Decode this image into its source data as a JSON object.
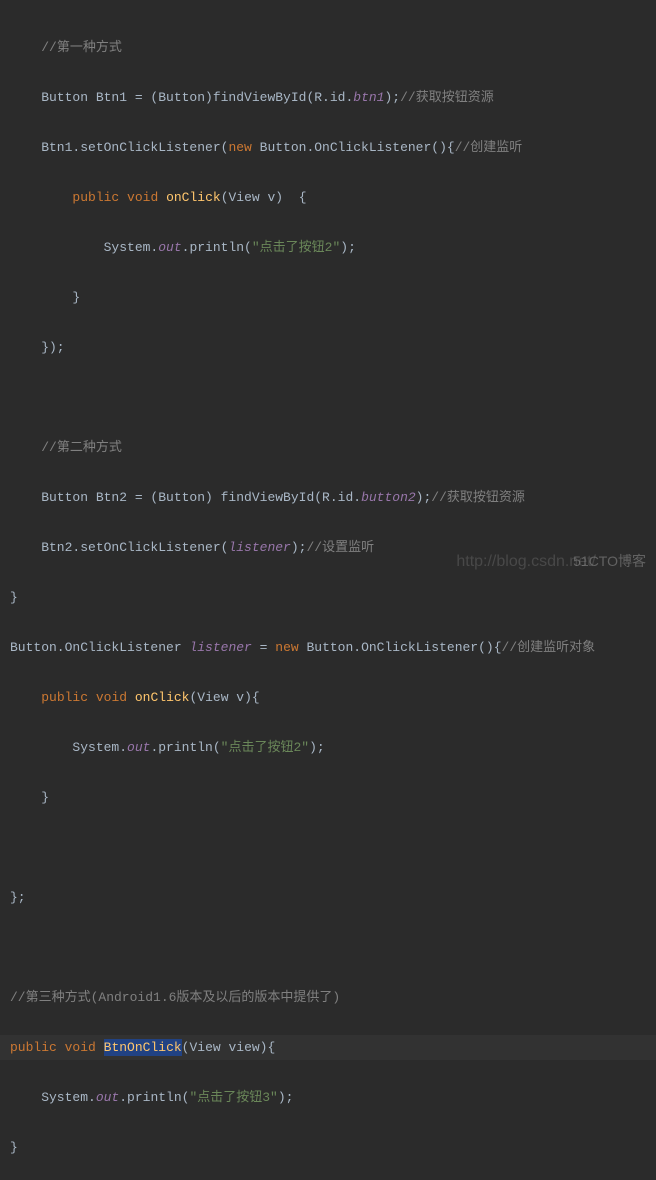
{
  "code": {
    "c1": "//第一种方式",
    "btn1_decl_a": "    Button Btn1 = (Button)findViewById(R.id.",
    "btn1_field": "btn1",
    "btn1_decl_b": ");",
    "btn1_comment": "//获取按钮资源",
    "btn1_listener_a": "    Btn1.setOnClickListener(",
    "kw_new1": "new",
    "btn1_listener_b": " Button.OnClickListener(){",
    "btn1_listener_comment": "//创建监听",
    "kw_public1": "public",
    "kw_void1": "void",
    "onclick1": "onClick",
    "onclick1_params": "(View v)  {",
    "sysout1_a": "            System.",
    "sysout1_field": "out",
    "sysout1_b": ".println(",
    "str1": "\"点击了按钮2\"",
    "sysout1_c": ");",
    "close_brace1": "        }",
    "close_paren1": "    });",
    "c2": "//第二种方式",
    "btn2_decl_a": "    Button Btn2 = (Button) findViewById(R.id.",
    "btn2_field": "button2",
    "btn2_decl_b": ");",
    "btn2_comment": "//获取按钮资源",
    "btn2_listener_a": "    Btn2.setOnClickListener(",
    "listener_var": "listener",
    "btn2_listener_b": ");",
    "btn2_listener_comment": "//设置监听",
    "close_brace2": "}",
    "listener_decl_a": "Button.OnClickListener ",
    "listener_decl_b": " = ",
    "kw_new2": "new",
    "listener_decl_c": " Button.OnClickListener(){",
    "listener_decl_comment": "//创建监听对象",
    "kw_public2": "public",
    "kw_void2": "void",
    "onclick2": "onClick",
    "onclick2_params": "(View v){",
    "sysout2_a": "        System.",
    "sysout2_field": "out",
    "sysout2_b": ".println(",
    "str2": "\"点击了按钮2\"",
    "sysout2_c": ");",
    "close_brace3": "    }",
    "close_brace4": "};",
    "c3": "//第三种方式(Android1.6版本及以后的版本中提供了)",
    "kw_public3": "public",
    "kw_void3": "void",
    "btnonclick": "BtnOnClick",
    "btnonclick_params": "(View view){",
    "sysout3_a": "    System.",
    "sysout3_field": "out",
    "sysout3_b": ".println(",
    "str3": "\"点击了按钮3\"",
    "sysout3_c": ");",
    "close_brace5": "}"
  },
  "watermark1": "http://blog.csdn.net/",
  "watermark2": "51CTO博客"
}
